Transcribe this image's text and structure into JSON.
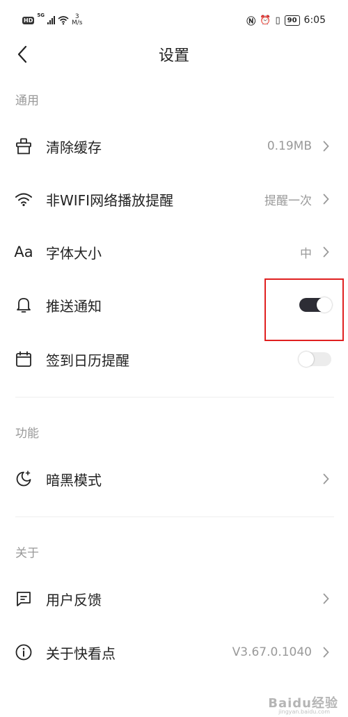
{
  "status_bar": {
    "hd": "HD",
    "net": "5G",
    "speed_value": "3",
    "speed_unit": "M/s",
    "battery": "90",
    "time": "6:05"
  },
  "header": {
    "title": "设置"
  },
  "sections": {
    "general": "通用",
    "features": "功能",
    "about": "关于"
  },
  "rows": {
    "clear_cache": {
      "label": "清除缓存",
      "value": "0.19MB"
    },
    "non_wifi": {
      "label": "非WIFI网络播放提醒",
      "value": "提醒一次"
    },
    "font_size": {
      "label": "字体大小",
      "value": "中",
      "icon_text": "Aa"
    },
    "push": {
      "label": "推送通知",
      "toggle_on": true
    },
    "checkin": {
      "label": "签到日历提醒",
      "toggle_on": false
    },
    "dark_mode": {
      "label": "暗黑模式"
    },
    "feedback": {
      "label": "用户反馈"
    },
    "about_app": {
      "label": "关于快看点",
      "value": "V3.67.0.1040"
    }
  },
  "annotation": {
    "color": "#e02020"
  },
  "watermark": {
    "text": "Baidu经验",
    "sub": "jingyan.baidu.com"
  }
}
